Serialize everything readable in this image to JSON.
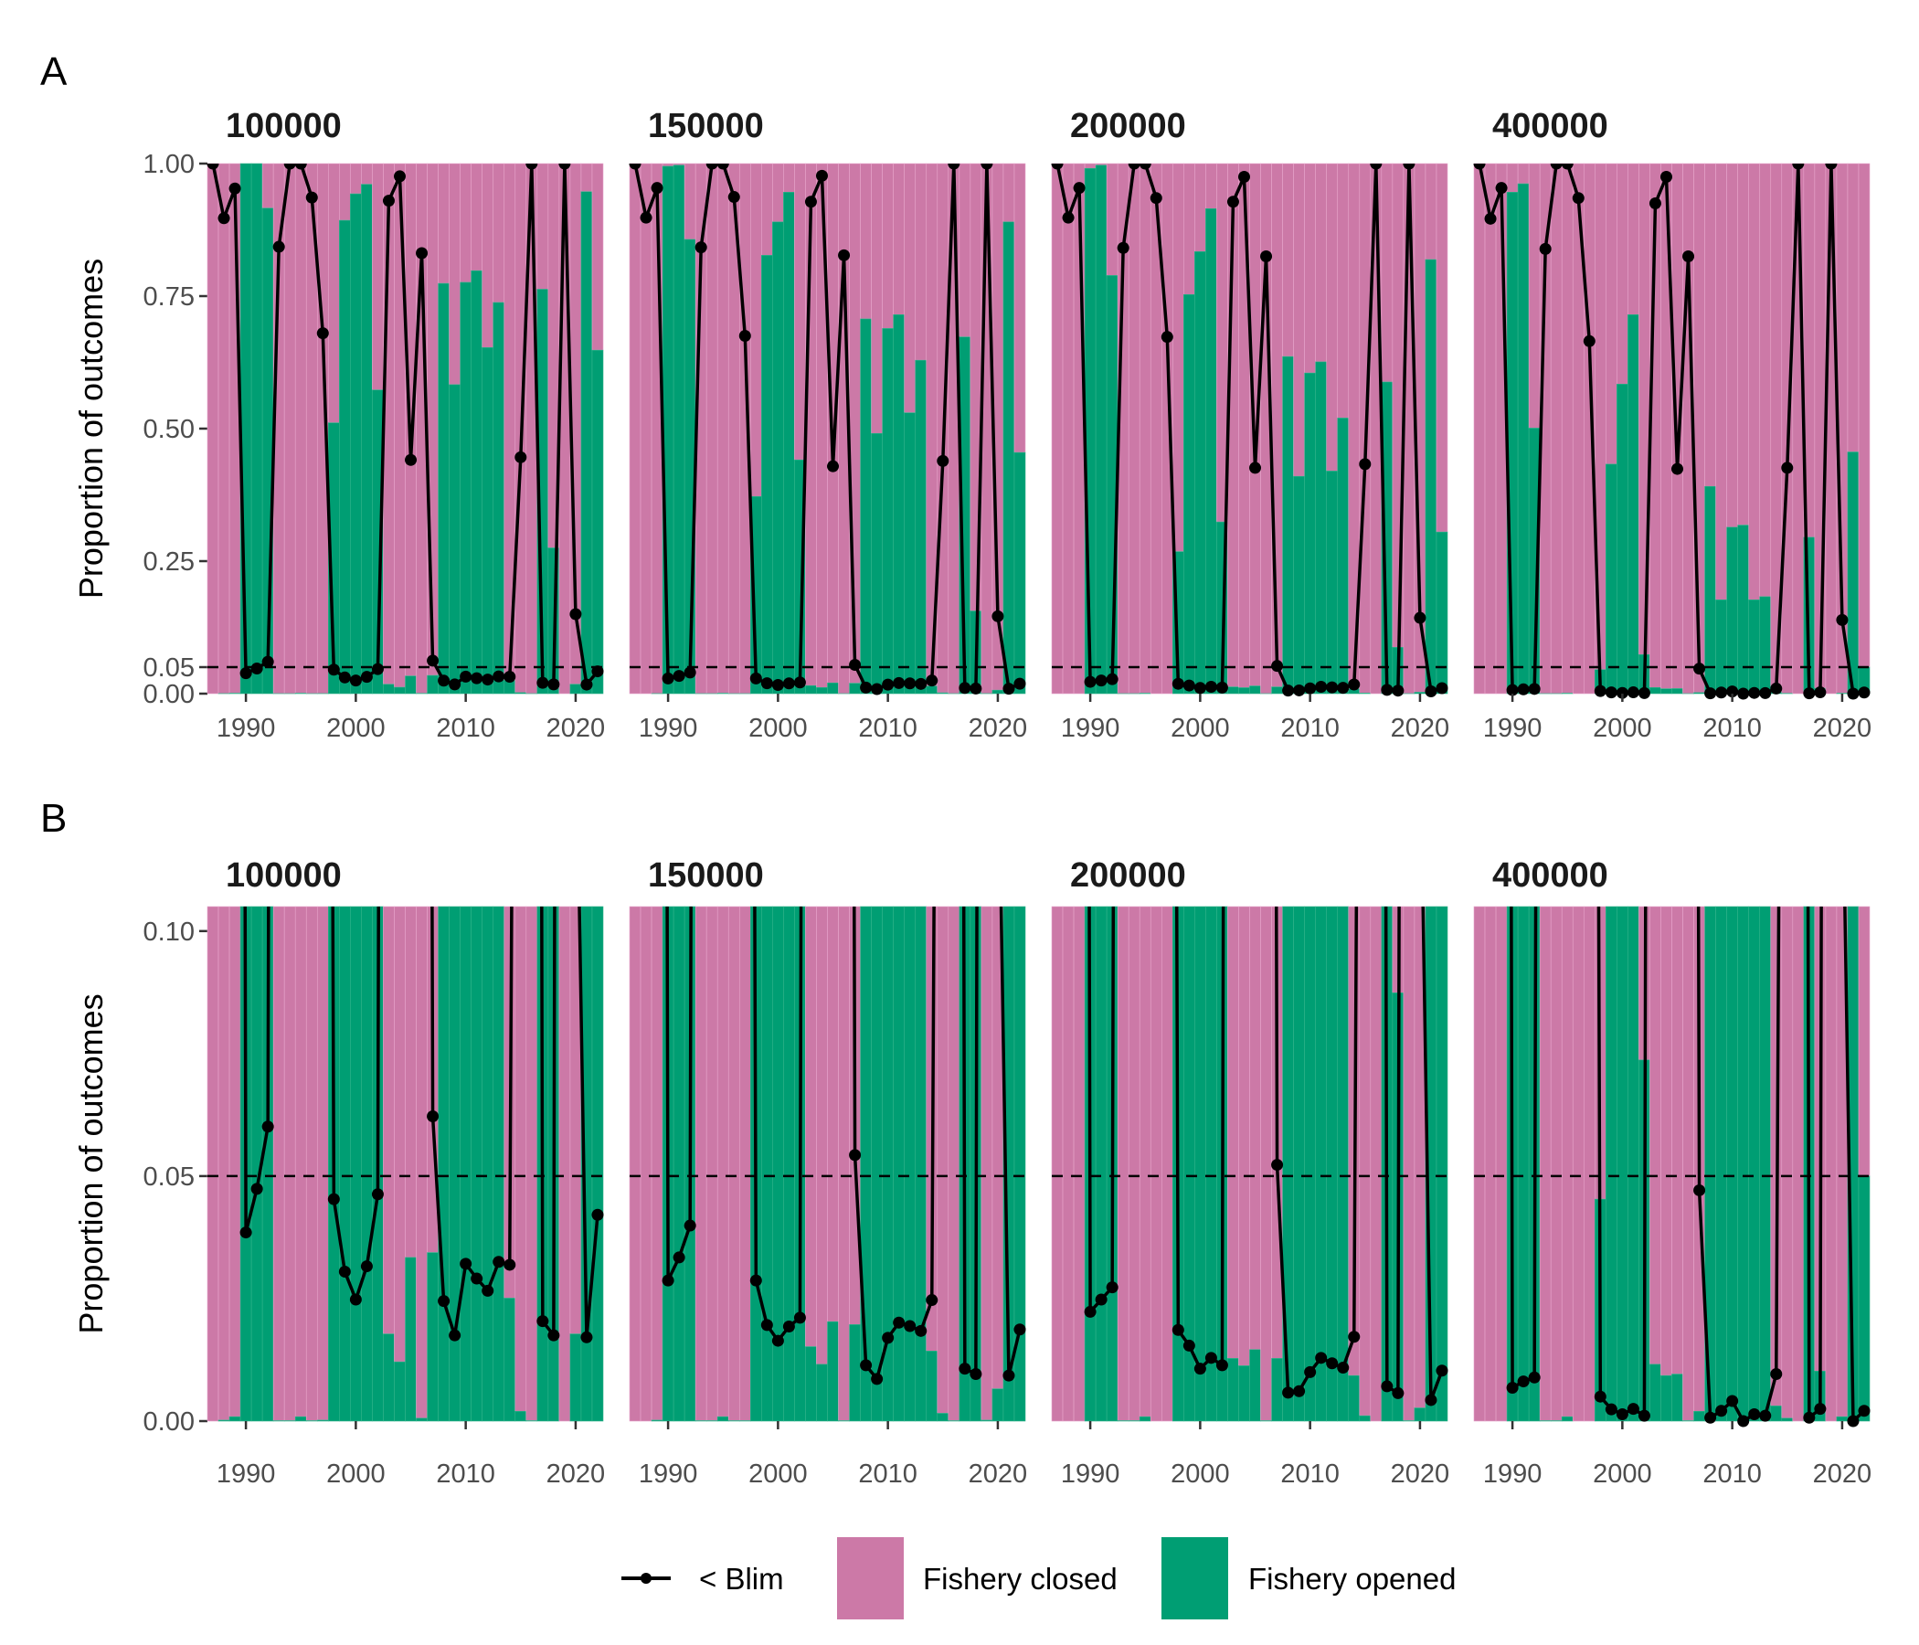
{
  "chart_data": {
    "type": "bar",
    "description": "Stacked proportion bars (fishery opened vs closed) per year with line of proportion below Blim, faceted by threshold",
    "years": [
      1987,
      1988,
      1989,
      1990,
      1991,
      1992,
      1993,
      1994,
      1995,
      1996,
      1997,
      1998,
      1999,
      2000,
      2001,
      2002,
      2003,
      2004,
      2005,
      2006,
      2007,
      2008,
      2009,
      2010,
      2011,
      2012,
      2013,
      2014,
      2015,
      2016,
      2017,
      2018,
      2019,
      2020,
      2021,
      2022
    ],
    "facets": [
      {
        "title": "100000",
        "opened": [
          0,
          0.0002,
          0.0009,
          1.0,
          1.0,
          0.916,
          0.0001,
          0.0001,
          0.0009,
          0.0001,
          0.0002,
          0.511,
          0.893,
          0.943,
          0.961,
          0.573,
          0.0178,
          0.0121,
          0.0334,
          0.0006,
          0.0344,
          0.774,
          0.583,
          0.776,
          0.798,
          0.653,
          0.738,
          0.0251,
          0.002,
          0.0001,
          0.763,
          0.275,
          0,
          0.0178,
          0.947,
          0.648
        ],
        "blim": [
          1.0,
          0.897,
          0.953,
          0.0385,
          0.0474,
          0.0601,
          0.843,
          1.0,
          1.0,
          0.936,
          0.68,
          0.0453,
          0.0305,
          0.0248,
          0.0316,
          0.0463,
          0.93,
          0.976,
          0.441,
          0.831,
          0.0622,
          0.0245,
          0.0175,
          0.0321,
          0.0291,
          0.0266,
          0.0325,
          0.0319,
          0.446,
          1.0,
          0.0204,
          0.0175,
          1.0,
          0.15,
          0.0171,
          0.0421
        ]
      },
      {
        "title": "150000",
        "opened": [
          0,
          0,
          0.0002,
          0.995,
          0.997,
          0.857,
          0.0001,
          0.0001,
          0.0009,
          0.0001,
          0.0001,
          0.372,
          0.827,
          0.89,
          0.946,
          0.441,
          0.0152,
          0.0116,
          0.0203,
          0.0001,
          0.0197,
          0.707,
          0.491,
          0.689,
          0.715,
          0.53,
          0.629,
          0.0143,
          0.0016,
          0.0001,
          0.673,
          0.156,
          0.0002,
          0.0066,
          0.89,
          0.455
        ],
        "blim": [
          1.0,
          0.898,
          0.954,
          0.0287,
          0.0334,
          0.0399,
          0.842,
          1.0,
          1.0,
          0.937,
          0.675,
          0.0287,
          0.0196,
          0.0164,
          0.0193,
          0.0211,
          0.928,
          0.977,
          0.429,
          0.827,
          0.0543,
          0.0114,
          0.0086,
          0.017,
          0.0201,
          0.0194,
          0.0184,
          0.0247,
          0.439,
          1.0,
          0.0107,
          0.0096,
          1.0,
          0.146,
          0.0093,
          0.0187
        ]
      },
      {
        "title": "200000",
        "opened": [
          0,
          0,
          0,
          0.991,
          0.997,
          0.789,
          0.0001,
          0.0001,
          0.0009,
          0,
          0,
          0.268,
          0.753,
          0.834,
          0.915,
          0.324,
          0.0128,
          0.0113,
          0.0146,
          0.0001,
          0.0128,
          0.636,
          0.41,
          0.605,
          0.626,
          0.42,
          0.52,
          0.0093,
          0.0011,
          0,
          0.588,
          0.0874,
          0.0001,
          0.0027,
          0.819,
          0.305
        ],
        "blim": [
          1.0,
          0.898,
          0.954,
          0.0223,
          0.0248,
          0.0273,
          0.841,
          1.0,
          1.0,
          0.935,
          0.673,
          0.0186,
          0.0154,
          0.0107,
          0.0129,
          0.0114,
          0.928,
          0.975,
          0.426,
          0.825,
          0.0523,
          0.0058,
          0.0061,
          0.01,
          0.0129,
          0.0118,
          0.0109,
          0.0172,
          0.433,
          1.0,
          0.0071,
          0.0057,
          1.0,
          0.143,
          0.0043,
          0.0103
        ]
      },
      {
        "title": "400000",
        "opened": [
          0,
          0,
          0,
          0.946,
          0.962,
          0.501,
          0.0001,
          0.0001,
          0.0009,
          0,
          0,
          0.0453,
          0.433,
          0.584,
          0.715,
          0.0737,
          0.0116,
          0.0093,
          0.0096,
          0.0001,
          0.002,
          0.391,
          0.177,
          0.314,
          0.318,
          0.177,
          0.183,
          0.0031,
          0.0006,
          0,
          0.295,
          0.0102,
          0,
          0.0009,
          0.456,
          0.05
        ],
        "blim": [
          1.0,
          0.896,
          0.954,
          0.0068,
          0.0081,
          0.0089,
          0.839,
          1.0,
          1.0,
          0.935,
          0.665,
          0.005,
          0.0024,
          0.0014,
          0.0025,
          0.0011,
          0.925,
          0.975,
          0.424,
          0.825,
          0.0471,
          0.0007,
          0.0021,
          0.0041,
          0.0,
          0.0014,
          0.0011,
          0.0096,
          0.426,
          1.0,
          0.0007,
          0.0025,
          1.0,
          0.139,
          0.0,
          0.0021
        ]
      }
    ],
    "rows": [
      {
        "label": "A",
        "ylabel": "Proportion of outcomes",
        "ylim": [
          0,
          1.0
        ],
        "yticks": [
          0,
          0.05,
          0.25,
          0.5,
          0.75,
          1.0
        ],
        "ytick_labels": [
          "0.00",
          "0.05",
          "0.25",
          "0.50",
          "0.75",
          "1.00"
        ]
      },
      {
        "label": "B",
        "ylabel": "Proportion of outcomes",
        "ylim": [
          0,
          0.105
        ],
        "yticks": [
          0,
          0.05,
          0.1
        ],
        "ytick_labels": [
          "0.00",
          "0.05",
          "0.10"
        ]
      }
    ],
    "xticks": [
      1990,
      2000,
      2010,
      2020
    ],
    "xtick_labels": [
      "1990",
      "2000",
      "2010",
      "2020"
    ],
    "xlim": [
      1986.5,
      2022.5
    ],
    "reference_line": {
      "y": 0.05,
      "style": "dashed"
    },
    "legend": {
      "position": "bottom",
      "entries": [
        {
          "label": "< Blim",
          "kind": "line-point",
          "color": "#000000"
        },
        {
          "label": "Fishery closed",
          "kind": "fill",
          "color": "#CC79A7"
        },
        {
          "label": "Fishery opened",
          "kind": "fill",
          "color": "#009E73"
        }
      ]
    },
    "colors": {
      "closed": "#CC79A7",
      "opened": "#009E73",
      "line": "#000000",
      "divider": "#E8A6CC"
    },
    "grid": false
  }
}
